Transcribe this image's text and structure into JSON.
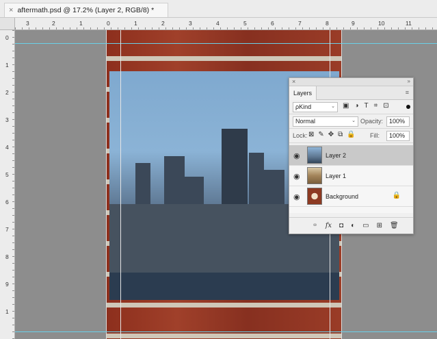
{
  "document": {
    "tab_title": "aftermath.psd @ 17.2% (Layer 2, RGB/8) *",
    "close_glyph": "×"
  },
  "rulers": {
    "top_labels": [
      "3",
      "2",
      "1",
      "0",
      "1",
      "2",
      "3",
      "4",
      "5",
      "6",
      "7",
      "8",
      "9",
      "10",
      "11"
    ],
    "left_labels": [
      "0",
      "1",
      "2",
      "3",
      "4",
      "5",
      "6",
      "7",
      "8",
      "9",
      "1"
    ]
  },
  "layers_panel": {
    "close_glyph": "×",
    "collapse_glyph": "»",
    "tab_label": "Layers",
    "menu_icon": "≡",
    "filter": {
      "kind_label": "ρKind",
      "arrow": "⌄",
      "icons": [
        "image-filter-icon",
        "adjustment-filter-icon",
        "type-filter-icon",
        "shape-filter-icon",
        "smart-object-filter-icon"
      ],
      "icon_glyphs": [
        "▣",
        "◑",
        "T",
        "⌗",
        "⊡"
      ]
    },
    "blend_mode": "Normal",
    "opacity_label": "Opacity:",
    "opacity_value": "100%",
    "lock_label": "Lock:",
    "lock_glyphs": [
      "⊠",
      "✎",
      "✥",
      "⧉",
      "🔒"
    ],
    "fill_label": "Fill:",
    "fill_value": "100%",
    "layers": [
      {
        "name": "Layer 2",
        "selected": true,
        "visible": true,
        "locked": false
      },
      {
        "name": "Layer 1",
        "selected": false,
        "visible": true,
        "locked": false
      },
      {
        "name": "Background",
        "selected": false,
        "visible": true,
        "locked": true
      }
    ],
    "eye_glyph": "◉",
    "lock_glyph": "🔒",
    "bottom_icons": {
      "link": "⚭",
      "fx": "fx",
      "mask": "◘",
      "adjust": "◐",
      "group": "▭",
      "new": "⊞",
      "delete": "🗑"
    }
  },
  "colors": {
    "selected_layer": "#c9c9c9",
    "guide": "#6ad0e8",
    "canvas_bg": "#8d8d8d",
    "brick": "#9a3c27"
  }
}
